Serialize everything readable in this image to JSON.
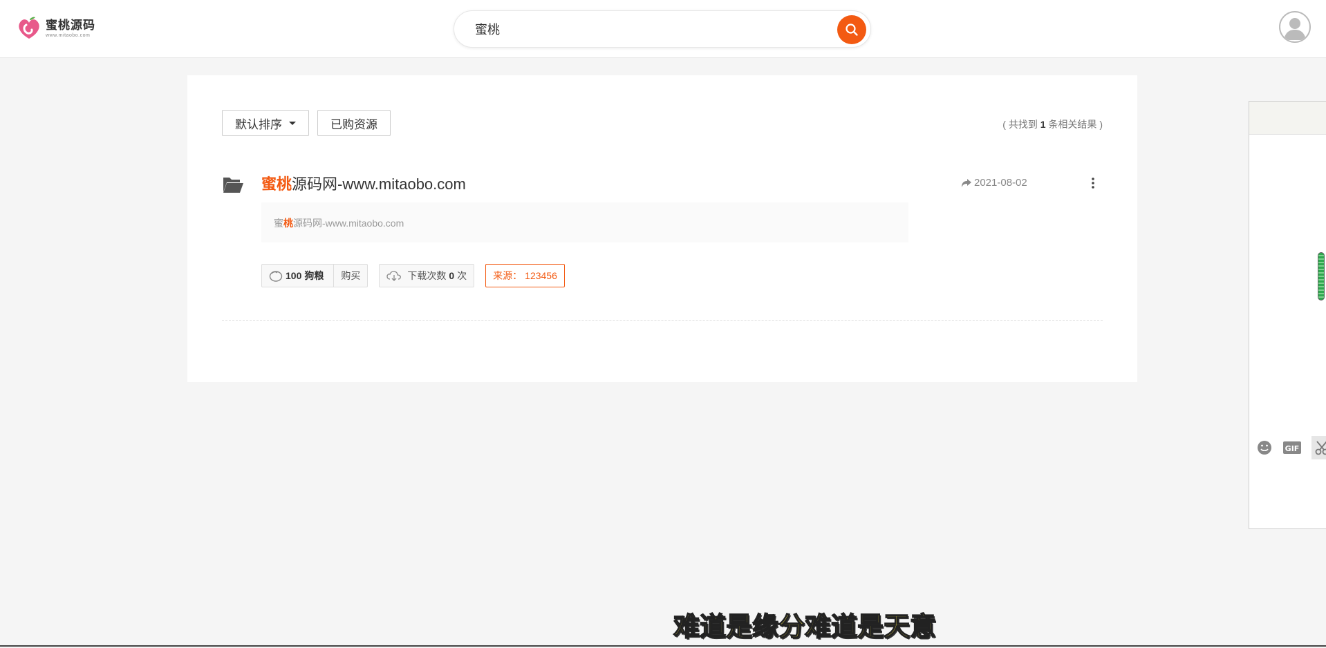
{
  "header": {
    "logo_title": "蜜桃源码",
    "logo_sub": "www.mitaobo.com",
    "search_value": "蜜桃"
  },
  "toolbar": {
    "sort_label": "默认排序",
    "purchased_label": "已购资源"
  },
  "results": {
    "prefix": "( 共找到 ",
    "count": "1",
    "suffix": " 条相关结果 )"
  },
  "item": {
    "title_highlight": "蜜桃",
    "title_rest": "源码网-www.mitaobo.com",
    "date": "2021-08-02",
    "desc_pre": "蜜",
    "desc_highlight": "桃",
    "desc_rest": "源码网-www.mitaobo.com",
    "price_value": "100",
    "price_unit": "狗粮",
    "buy_label": "购买",
    "downloads_label": "下载次数",
    "downloads_count": "0",
    "downloads_unit": "次",
    "source_label": "来源：",
    "source_value": "123456"
  },
  "chat": {
    "gif_label": "GIF"
  },
  "subtitle": "难道是缘分难道是天意",
  "colors": {
    "accent": "#f35a12",
    "background": "#f5f5f5",
    "card": "#ffffff"
  }
}
